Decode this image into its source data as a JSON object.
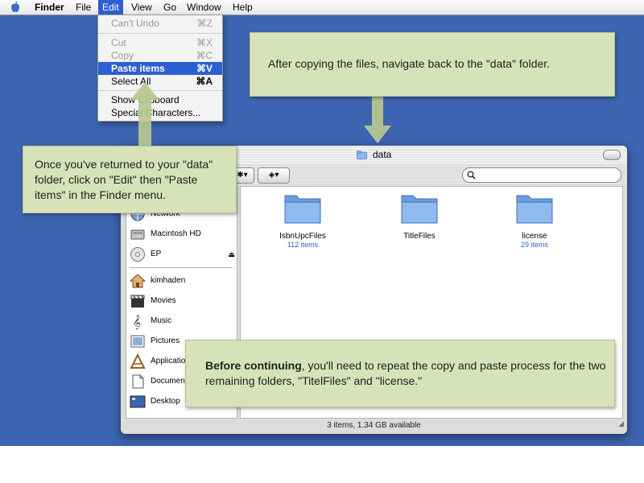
{
  "menubar": {
    "app": "Finder",
    "items": [
      "File",
      "Edit",
      "View",
      "Go",
      "Window",
      "Help"
    ]
  },
  "edit_menu": {
    "items": [
      {
        "label": "Can't Undo",
        "shortcut": "⌘Z"
      },
      {
        "label": "Cut",
        "shortcut": "⌘X"
      },
      {
        "label": "Copy",
        "shortcut": "⌘C"
      },
      {
        "label": "Paste items",
        "shortcut": "⌘V"
      },
      {
        "label": "Select All",
        "shortcut": "⌘A"
      },
      {
        "label": "Show Clipboard",
        "shortcut": ""
      },
      {
        "label": "Special Characters...",
        "shortcut": ""
      }
    ]
  },
  "callouts": {
    "top": "After copying the files, navigate back to the \"data\" folder.",
    "left": "Once you've returned to your \"data\" folder, click on \"Edit\" then \"Paste items\" in the Finder menu.",
    "bottom_bold": "Before continuing",
    "bottom_rest": ", you'll need to repeat the copy and paste process for the two remaining folders, \"TitelFiles\" and \"license.\""
  },
  "window": {
    "title": "data",
    "status": "3 items, 1.34 GB available"
  },
  "sidebar": {
    "items": [
      "Network",
      "Macintosh HD",
      "EP",
      "kimhaden",
      "Movies",
      "Music",
      "Pictures",
      "Applications",
      "Documents",
      "Desktop"
    ]
  },
  "folders": [
    {
      "name": "IsbnUpcFiles",
      "count": "112 items"
    },
    {
      "name": "TitleFiles",
      "count": ""
    },
    {
      "name": "license",
      "count": "29 items"
    }
  ],
  "colors": {
    "desktop": "#3d64b0",
    "highlight": "#2c5fd1",
    "callout": "#d8e2b8",
    "arrow": "#b7c98f"
  }
}
